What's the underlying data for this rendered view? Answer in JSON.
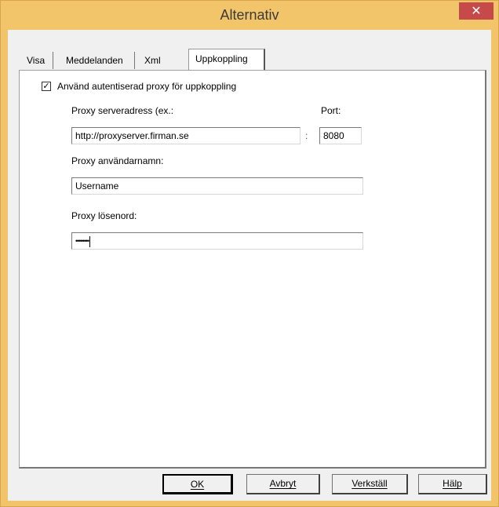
{
  "window": {
    "title": "Alternativ",
    "close_glyph": "✕",
    "accent_color": "#f3c56b",
    "close_color": "#c74a4a"
  },
  "tabs": [
    {
      "label": "Visa",
      "active": false
    },
    {
      "label": "Meddelanden",
      "active": false
    },
    {
      "label": "Xml",
      "active": false
    },
    {
      "label": "Uppkoppling",
      "active": true
    }
  ],
  "proxy": {
    "use_proxy_label": "Använd autentiserad proxy för uppkoppling",
    "use_proxy_checked": true,
    "check_glyph": "✓",
    "server_label": "Proxy serveradress (ex.:",
    "server_value": "http://proxyserver.firman.se",
    "port_separator": ":",
    "port_label": "Port:",
    "port_value": "8080",
    "username_label": "Proxy användarnamn:",
    "username_value": "Username",
    "password_label": "Proxy lösenord:",
    "password_value": "••••••••"
  },
  "buttons": {
    "ok": "OK",
    "cancel": "Avbryt",
    "apply": "Verkställ",
    "help": "Hälp"
  }
}
